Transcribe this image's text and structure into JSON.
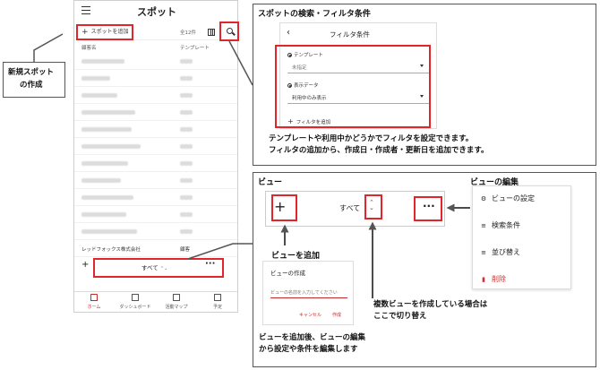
{
  "phone": {
    "title": "スポット",
    "add_spot": "スポットを追加",
    "count": "全12件",
    "col_customer": "顧客名",
    "col_template": "テンプレート",
    "last_row_name": "レッドフォックス株式会社",
    "last_row_template": "顧客",
    "view_all": "すべて",
    "tabs": [
      "ホーム",
      "ダッシュボード",
      "活動マップ",
      "予定"
    ]
  },
  "filter": {
    "section_title": "スポットの検索・フィルタ条件",
    "panel_title": "フィルタ条件",
    "template_label": "テンプレート",
    "template_value": "未指定",
    "display_label": "表示データ",
    "display_value": "利用中のみ表示",
    "add_filter": "フィルタを追加",
    "desc_line1": "テンプレートや利用中かどうかでフィルタを設定できます。",
    "desc_line2": "フィルタの追加から、作成日・作成者・更新日を追加できます。"
  },
  "new_spot_callout": {
    "line1": "新規スポット",
    "line2": "の作成"
  },
  "view": {
    "section_title": "ビュー",
    "all_label": "すべて",
    "add_view_label": "ビューを追加",
    "edit_title": "ビューの編集",
    "menu": [
      "ビューの設定",
      "検索条件",
      "並び替え",
      "削除"
    ],
    "switch_line1": "複数ビューを作成している場合は",
    "switch_line2": "ここで切り替え",
    "dialog_title": "ビューの作成",
    "dialog_placeholder": "ビューの名前を入力してください",
    "dialog_cancel": "キャンセル",
    "dialog_ok": "作成",
    "after_line1": "ビューを追加後、ビューの編集",
    "after_line2": "から設定や条件を編集します"
  }
}
